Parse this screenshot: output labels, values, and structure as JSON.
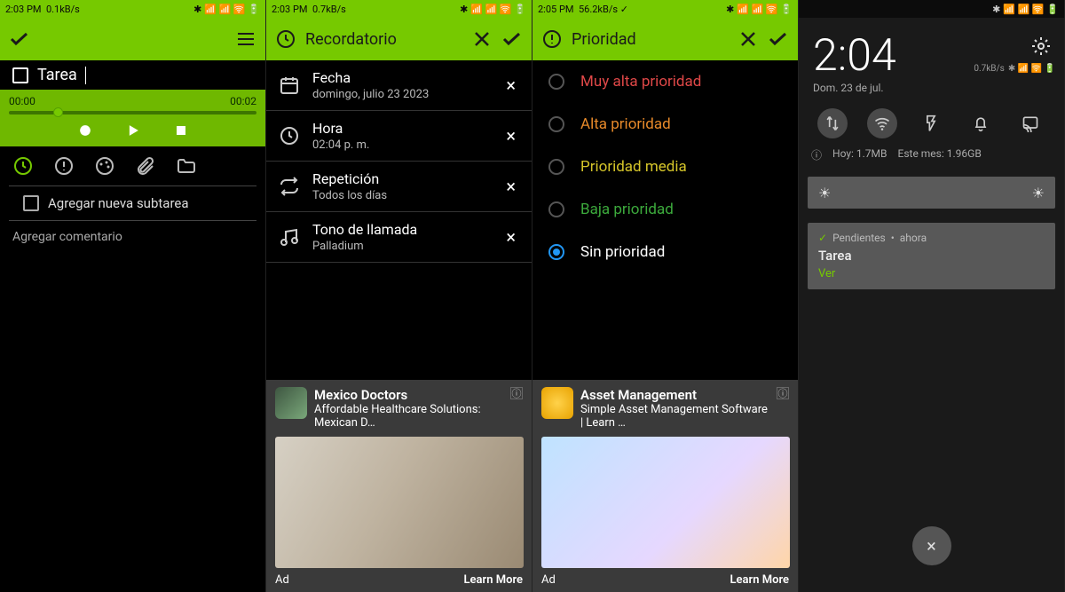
{
  "s1": {
    "status_time": "2:03 PM",
    "status_net": "0.1kB/s",
    "task_label": "Tarea",
    "audio_start": "00:00",
    "audio_end": "00:02",
    "subtask_label": "Agregar nueva subtarea",
    "comment_placeholder": "Agregar comentario"
  },
  "s2": {
    "status_time": "2:03 PM",
    "status_net": "0.7kB/s",
    "title": "Recordatorio",
    "rows": [
      {
        "title": "Fecha",
        "sub": "domingo, julio 23 2023"
      },
      {
        "title": "Hora",
        "sub": "02:04 p. m."
      },
      {
        "title": "Repetición",
        "sub": "Todos los días"
      },
      {
        "title": "Tono de llamada",
        "sub": "Palladium"
      }
    ],
    "ad": {
      "title": "Mexico Doctors",
      "sub": "Affordable Healthcare Solutions: Mexican D…",
      "label": "Ad",
      "cta": "Learn More"
    }
  },
  "s3": {
    "status_time": "2:05 PM",
    "status_net": "56.2kB/s",
    "title": "Prioridad",
    "options": [
      {
        "label": "Muy alta prioridad",
        "color": "#e04848"
      },
      {
        "label": "Alta prioridad",
        "color": "#e88a2a"
      },
      {
        "label": "Prioridad media",
        "color": "#d6c62a"
      },
      {
        "label": "Baja prioridad",
        "color": "#3caa3c"
      },
      {
        "label": "Sin prioridad",
        "color": "#ffffff"
      }
    ],
    "selected": 4,
    "ad": {
      "title": "Asset Management",
      "sub": "Simple Asset Management Software | Learn …",
      "label": "Ad",
      "cta": "Learn More"
    }
  },
  "s4": {
    "clock": "2:04",
    "date": "Dom. 23 de jul.",
    "net": "0.7kB/s",
    "usage_today": "Hoy: 1.7MB",
    "usage_month": "Este mes: 1.96GB",
    "notif_app": "Pendientes",
    "notif_when": "ahora",
    "notif_title": "Tarea",
    "notif_action": "Ver"
  }
}
